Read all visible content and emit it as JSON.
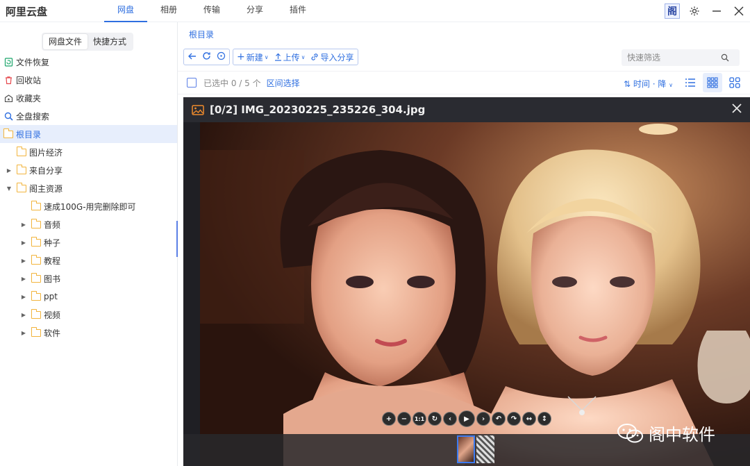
{
  "app": {
    "title": "阿里云盘"
  },
  "menu": {
    "items": [
      {
        "label": "网盘",
        "active": true
      },
      {
        "label": "相册"
      },
      {
        "label": "传输"
      },
      {
        "label": "分享"
      },
      {
        "label": "插件"
      }
    ]
  },
  "window": {
    "logo_text": "阁"
  },
  "sidebar": {
    "tabs": [
      "网盘文件",
      "快捷方式"
    ],
    "nav": [
      {
        "label": "文件恢复",
        "icon": "file-restore-icon"
      },
      {
        "label": "回收站",
        "icon": "trash-icon"
      },
      {
        "label": "收藏夹",
        "icon": "favorites-icon"
      },
      {
        "label": "全盘搜索",
        "icon": "search-icon"
      },
      {
        "label": "根目录",
        "icon": "folder-icon"
      }
    ],
    "tree": [
      {
        "label": "图片经济",
        "expander": "",
        "level": 1
      },
      {
        "label": "来自分享",
        "expander": "▶",
        "level": 1
      },
      {
        "label": "阁主资源",
        "expander": "▼",
        "level": 1
      },
      {
        "label": "速成100G-用完删除即可",
        "expander": "",
        "level": 2
      },
      {
        "label": "音频",
        "expander": "▶",
        "level": 2
      },
      {
        "label": "种子",
        "expander": "▶",
        "level": 2
      },
      {
        "label": "教程",
        "expander": "▶",
        "level": 2
      },
      {
        "label": "图书",
        "expander": "▶",
        "level": 2
      },
      {
        "label": "ppt",
        "expander": "▶",
        "level": 2
      },
      {
        "label": "视频",
        "expander": "▶",
        "level": 2
      },
      {
        "label": "软件",
        "expander": "▶",
        "level": 2
      }
    ]
  },
  "main": {
    "breadcrumb": "根目录",
    "toolbar": {
      "new_label": "新建",
      "upload_label": "上传",
      "import_share_label": "导入分享"
    },
    "search": {
      "placeholder": "快速筛选"
    },
    "selection": {
      "count_text": "已选中 0 / 5 个",
      "range_label": "区间选择"
    },
    "sort": {
      "label": "时间 · 降"
    }
  },
  "viewer": {
    "title": "[0/2] IMG_20230225_235226_304.jpg",
    "controls": [
      "+",
      "−",
      "1:1",
      "↻",
      "‹",
      "▶",
      "›",
      "↶",
      "↷",
      "↔",
      "↕"
    ],
    "watermark": "阁中软件"
  },
  "colors": {
    "accent": "#2f6fe0",
    "folder": "#f2b43c",
    "viewer_bg": "#1f1f24"
  }
}
